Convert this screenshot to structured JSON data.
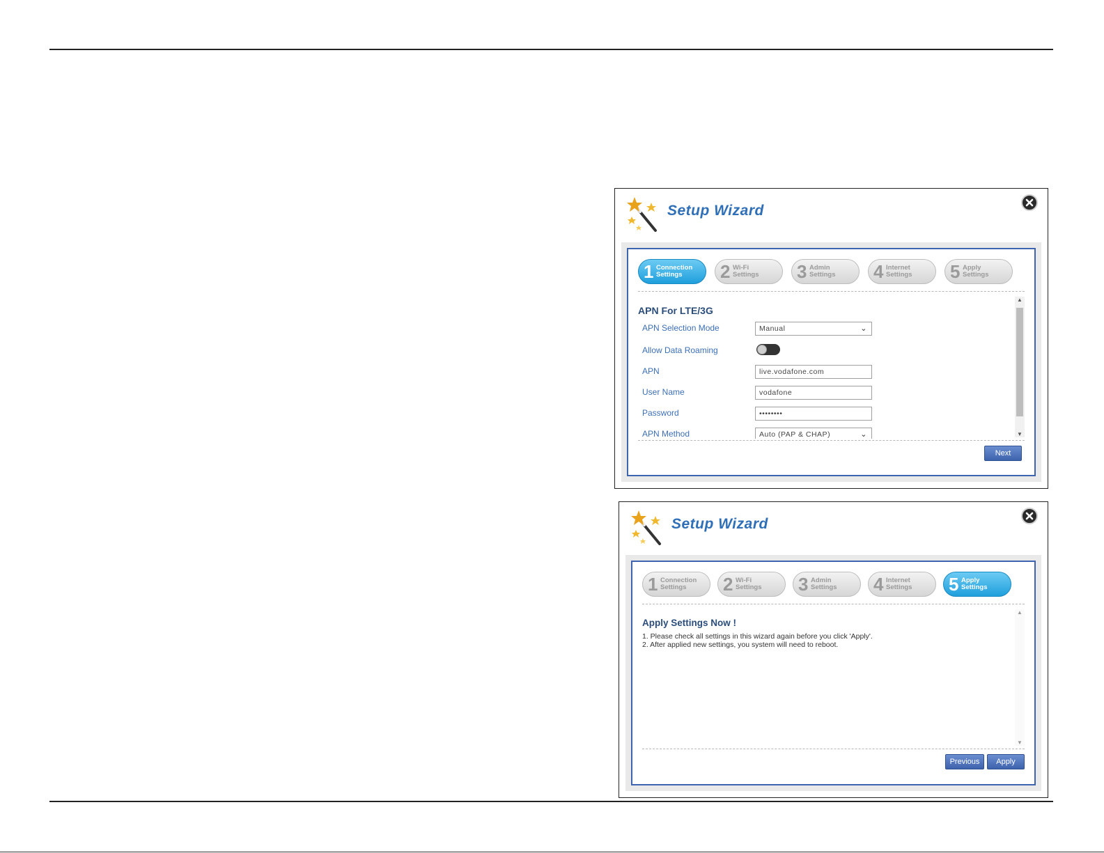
{
  "wizard1": {
    "title": "Setup Wizard",
    "steps": [
      {
        "num": "1",
        "line1": "Connection",
        "line2": "Settings"
      },
      {
        "num": "2",
        "line1": "Wi-Fi",
        "line2": "Settings"
      },
      {
        "num": "3",
        "line1": "Admin",
        "line2": "Settings"
      },
      {
        "num": "4",
        "line1": "Internet",
        "line2": "Settings"
      },
      {
        "num": "5",
        "line1": "Apply",
        "line2": "Settings"
      }
    ],
    "active_step": 1,
    "section_title": "APN For LTE/3G",
    "fields": {
      "apn_mode_label": "APN Selection Mode",
      "apn_mode_value": "Manual",
      "roaming_label": "Allow Data Roaming",
      "roaming_on": false,
      "apn_label": "APN",
      "apn_value": "live.vodafone.com",
      "username_label": "User Name",
      "username_value": "vodafone",
      "password_label": "Password",
      "password_value": "••••••••",
      "apn_method_label": "APN Method",
      "apn_method_value": "Auto (PAP & CHAP)"
    },
    "next_label": "Next"
  },
  "wizard2": {
    "title": "Setup Wizard",
    "steps": [
      {
        "num": "1",
        "line1": "Connection",
        "line2": "Settings"
      },
      {
        "num": "2",
        "line1": "Wi-Fi",
        "line2": "Settings"
      },
      {
        "num": "3",
        "line1": "Admin",
        "line2": "Settings"
      },
      {
        "num": "4",
        "line1": "Internet",
        "line2": "Settings"
      },
      {
        "num": "5",
        "line1": "Apply",
        "line2": "Settings"
      }
    ],
    "active_step": 5,
    "apply_title": "Apply Settings Now !",
    "lines": [
      "1. Please check all settings in this wizard again before you click 'Apply'.",
      "2. After applied new settings, you system will need to reboot."
    ],
    "previous_label": "Previous",
    "apply_label": "Apply"
  },
  "colors": {
    "title_blue": "#2f6fb7",
    "active_step": "#1f9fdc",
    "button_blue": "#3e63ad",
    "frame_border": "#3e64b0"
  },
  "icons": {
    "wand": "magic-wand-icon",
    "close": "close-icon"
  }
}
